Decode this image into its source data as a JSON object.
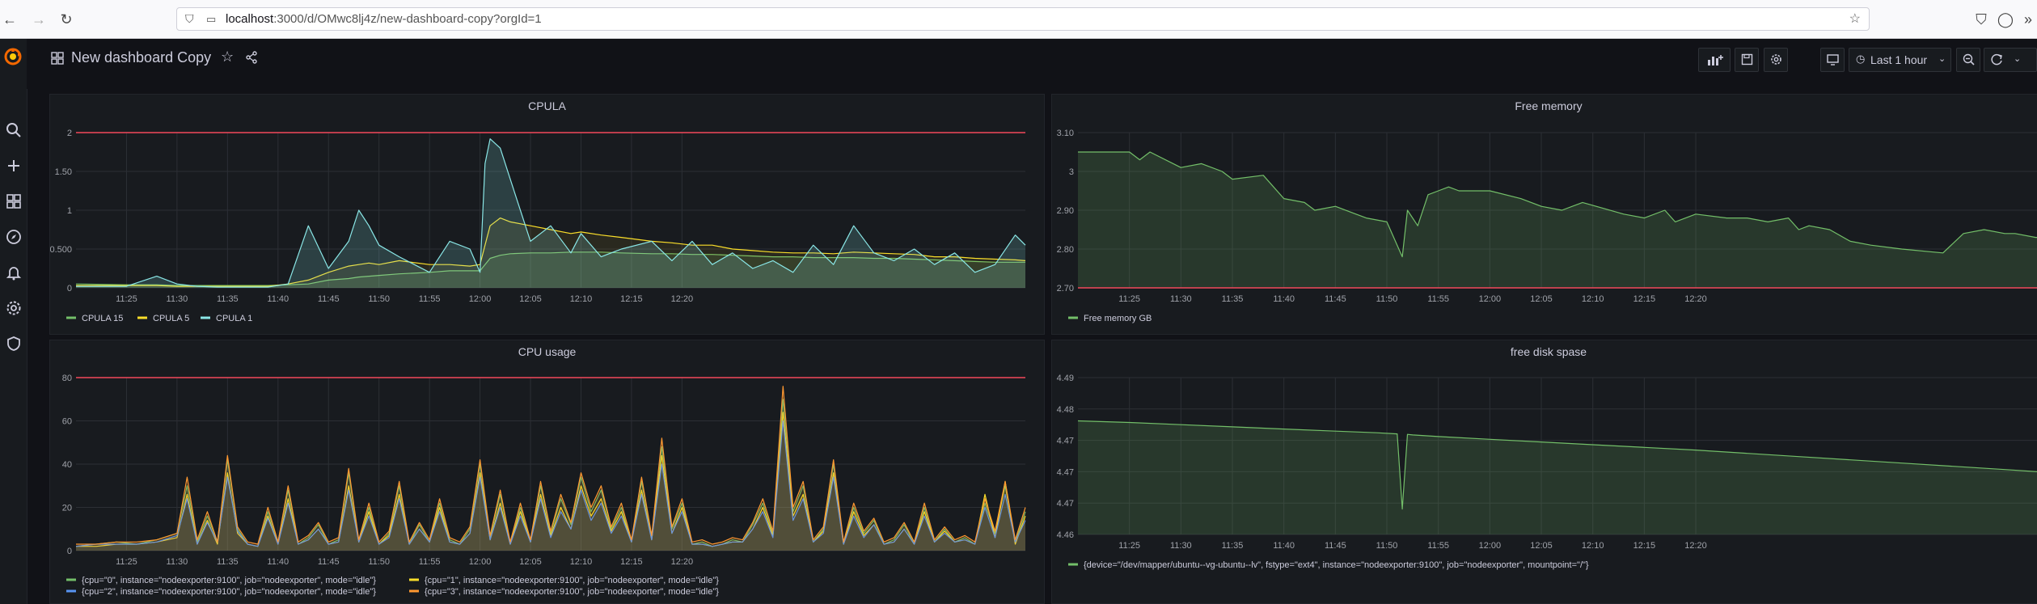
{
  "browser": {
    "url_host": "localhost",
    "url_path": ":3000/d/OMwc8lj4z/new-dashboard-copy?orgId=1"
  },
  "dashboard": {
    "title": "New dashboard Copy",
    "time_picker_label": "Last 1 hour"
  },
  "colors": {
    "green": "#73bf69",
    "yellow": "#fade2a",
    "teal": "#8ae7e7",
    "orange": "#ff9830",
    "blue": "#5794f2",
    "threshold": "#f2495c",
    "grafana_orange": "#f46800"
  },
  "panels": {
    "cpula": {
      "title": "CPULA",
      "legend": [
        "CPULA 15",
        "CPULA 5",
        "CPULA 1"
      ]
    },
    "free_memory": {
      "title": "Free memory",
      "legend": [
        "Free memory GB"
      ]
    },
    "cpu_usage": {
      "title": "CPU usage",
      "legend": [
        "{cpu=\"0\", instance=\"nodeexporter:9100\", job=\"nodeexporter\", mode=\"idle\"}",
        "{cpu=\"1\", instance=\"nodeexporter:9100\", job=\"nodeexporter\", mode=\"idle\"}",
        "{cpu=\"2\", instance=\"nodeexporter:9100\", job=\"nodeexporter\", mode=\"idle\"}",
        "{cpu=\"3\", instance=\"nodeexporter:9100\", job=\"nodeexporter\", mode=\"idle\"}"
      ]
    },
    "free_disk": {
      "title": "free disk spase",
      "legend": [
        "{device=\"/dev/mapper/ubuntu--vg-ubuntu--lv\", fstype=\"ext4\", instance=\"nodeexporter:9100\", job=\"nodeexporter\", mountpoint=\"/\"}"
      ]
    }
  },
  "chart_data": [
    {
      "type": "line",
      "title": "CPULA",
      "x_ticks": [
        "11:25",
        "11:30",
        "11:35",
        "11:40",
        "11:45",
        "11:50",
        "11:55",
        "12:00",
        "12:05",
        "12:10",
        "12:15",
        "12:20"
      ],
      "y_ticks": [
        "0",
        "0.500",
        "1",
        "1.50",
        "2"
      ],
      "ylim": [
        0,
        2
      ],
      "threshold": 2,
      "x_minutes": [
        -5,
        0,
        3,
        5,
        7,
        9,
        10,
        12,
        14,
        16,
        18,
        20,
        22,
        23,
        24,
        25,
        27,
        30,
        32,
        34,
        35,
        35.5,
        36,
        37,
        38,
        40,
        42,
        44,
        45,
        47,
        49,
        52,
        54,
        56,
        58,
        60,
        62,
        64,
        66,
        68,
        70,
        72,
        74,
        76,
        78,
        80,
        82,
        84,
        86,
        88,
        89
      ],
      "series": [
        {
          "name": "CPULA 15",
          "values": [
            0.05,
            0.04,
            0.04,
            0.03,
            0.03,
            0.03,
            0.03,
            0.03,
            0.03,
            0.04,
            0.05,
            0.1,
            0.12,
            0.14,
            0.15,
            0.16,
            0.18,
            0.2,
            0.22,
            0.22,
            0.22,
            0.3,
            0.38,
            0.42,
            0.44,
            0.45,
            0.45,
            0.46,
            0.46,
            0.46,
            0.45,
            0.44,
            0.44,
            0.43,
            0.43,
            0.42,
            0.41,
            0.4,
            0.4,
            0.39,
            0.39,
            0.39,
            0.38,
            0.38,
            0.37,
            0.36,
            0.35,
            0.34,
            0.33,
            0.33,
            0.33
          ]
        },
        {
          "name": "CPULA 5",
          "values": [
            0.03,
            0.03,
            0.03,
            0.02,
            0.02,
            0.02,
            0.02,
            0.02,
            0.02,
            0.05,
            0.1,
            0.2,
            0.28,
            0.3,
            0.32,
            0.3,
            0.35,
            0.3,
            0.3,
            0.28,
            0.3,
            0.55,
            0.8,
            0.9,
            0.85,
            0.8,
            0.75,
            0.7,
            0.72,
            0.68,
            0.65,
            0.6,
            0.58,
            0.55,
            0.55,
            0.5,
            0.48,
            0.46,
            0.45,
            0.45,
            0.44,
            0.46,
            0.45,
            0.44,
            0.43,
            0.4,
            0.4,
            0.38,
            0.37,
            0.36,
            0.35
          ]
        },
        {
          "name": "CPULA 1",
          "values": [
            0.02,
            0.02,
            0.15,
            0.05,
            0.02,
            0.01,
            0.01,
            0.01,
            0.01,
            0.05,
            0.8,
            0.25,
            0.6,
            1.0,
            0.8,
            0.55,
            0.4,
            0.2,
            0.6,
            0.5,
            0.2,
            1.6,
            1.92,
            1.8,
            1.4,
            0.6,
            0.8,
            0.45,
            0.7,
            0.4,
            0.5,
            0.6,
            0.35,
            0.6,
            0.3,
            0.45,
            0.25,
            0.35,
            0.2,
            0.55,
            0.3,
            0.8,
            0.45,
            0.35,
            0.5,
            0.3,
            0.45,
            0.2,
            0.3,
            0.68,
            0.55
          ]
        }
      ]
    },
    {
      "type": "area",
      "title": "Free memory",
      "x_ticks": [
        "11:25",
        "11:30",
        "11:35",
        "11:40",
        "11:45",
        "11:50",
        "11:55",
        "12:00",
        "12:05",
        "12:10",
        "12:15",
        "12:20"
      ],
      "y_ticks": [
        "2.70",
        "2.80",
        "2.90",
        "3",
        "3.10"
      ],
      "ylim": [
        2.7,
        3.1
      ],
      "threshold": 2.7,
      "x_minutes": [
        -5,
        0,
        1,
        2,
        5,
        7,
        9,
        10,
        13,
        15,
        17,
        18,
        20,
        22,
        23,
        25,
        26.5,
        27,
        28,
        29,
        30,
        31,
        32,
        35,
        38,
        40,
        42,
        44,
        48,
        50,
        52,
        53,
        55,
        58,
        60,
        62,
        64,
        65,
        66,
        68,
        70,
        72,
        75,
        79,
        81,
        83,
        85,
        86,
        88,
        89
      ],
      "series": [
        {
          "name": "Free memory GB",
          "values": [
            3.05,
            3.05,
            3.03,
            3.05,
            3.01,
            3.02,
            3.0,
            2.98,
            2.99,
            2.93,
            2.92,
            2.9,
            2.91,
            2.89,
            2.88,
            2.87,
            2.78,
            2.9,
            2.86,
            2.94,
            2.95,
            2.96,
            2.95,
            2.95,
            2.93,
            2.91,
            2.9,
            2.92,
            2.89,
            2.88,
            2.9,
            2.87,
            2.89,
            2.88,
            2.88,
            2.87,
            2.88,
            2.85,
            2.86,
            2.85,
            2.82,
            2.81,
            2.8,
            2.79,
            2.84,
            2.85,
            2.84,
            2.84,
            2.83,
            2.83
          ]
        }
      ]
    },
    {
      "type": "line",
      "title": "CPU usage",
      "x_ticks": [
        "11:25",
        "11:30",
        "11:35",
        "11:40",
        "11:45",
        "11:50",
        "11:55",
        "12:00",
        "12:05",
        "12:10",
        "12:15",
        "12:20"
      ],
      "y_ticks": [
        "0",
        "20",
        "40",
        "60",
        "80"
      ],
      "ylim": [
        0,
        80
      ],
      "threshold": 80,
      "x_minutes": [
        -5,
        -3,
        -1,
        1,
        3,
        5,
        6,
        7,
        8,
        9,
        10,
        11,
        12,
        13,
        14,
        15,
        16,
        17,
        18,
        19,
        20,
        21,
        22,
        23,
        24,
        25,
        26,
        27,
        28,
        29,
        30,
        31,
        32,
        33,
        34,
        35,
        36,
        37,
        38,
        39,
        40,
        41,
        42,
        43,
        44,
        45,
        46,
        47,
        48,
        49,
        50,
        51,
        52,
        53,
        54,
        55,
        56,
        57,
        58,
        59,
        60,
        61,
        62,
        63,
        64,
        65,
        66,
        67,
        68,
        69,
        70,
        71,
        72,
        73,
        74,
        75,
        76,
        77,
        78,
        79,
        80,
        81,
        82,
        83,
        84,
        85,
        86,
        87,
        88,
        89
      ],
      "series": [
        {
          "name": "{cpu=\"0\", instance=\"nodeexporter:9100\", job=\"nodeexporter\", mode=\"idle\"}",
          "values": [
            2,
            3,
            4,
            3,
            5,
            8,
            30,
            4,
            16,
            4,
            42,
            10,
            3,
            2,
            18,
            4,
            28,
            3,
            6,
            12,
            3,
            5,
            36,
            4,
            20,
            3,
            8,
            30,
            3,
            12,
            4,
            22,
            5,
            3,
            10,
            40,
            6,
            26,
            3,
            20,
            4,
            30,
            8,
            24,
            12,
            34,
            18,
            28,
            10,
            20,
            4,
            32,
            6,
            48,
            10,
            22,
            3,
            4,
            2,
            3,
            5,
            4,
            12,
            22,
            8,
            70,
            18,
            30,
            4,
            10,
            40,
            3,
            20,
            8,
            14,
            3,
            5,
            12,
            3,
            20,
            4,
            10,
            4,
            6,
            3,
            22,
            8,
            30,
            4,
            18
          ]
        },
        {
          "name": "{cpu=\"1\", instance=\"nodeexporter:9100\", job=\"nodeexporter\", mode=\"idle\"}",
          "values": [
            2,
            2,
            3,
            3,
            4,
            6,
            26,
            3,
            14,
            3,
            36,
            8,
            3,
            2,
            16,
            3,
            24,
            3,
            5,
            10,
            3,
            4,
            30,
            4,
            18,
            3,
            7,
            26,
            3,
            10,
            4,
            20,
            4,
            3,
            8,
            36,
            5,
            22,
            3,
            18,
            4,
            26,
            7,
            20,
            10,
            30,
            16,
            24,
            9,
            18,
            4,
            28,
            5,
            44,
            8,
            20,
            3,
            3,
            2,
            3,
            4,
            4,
            10,
            20,
            7,
            64,
            16,
            26,
            4,
            9,
            36,
            3,
            18,
            7,
            12,
            3,
            4,
            10,
            3,
            18,
            4,
            9,
            4,
            5,
            3,
            26,
            6,
            32,
            3,
            16
          ]
        },
        {
          "name": "{cpu=\"2\", instance=\"nodeexporter:9100\", job=\"nodeexporter\", mode=\"idle\"}",
          "values": [
            2,
            3,
            3,
            3,
            4,
            7,
            24,
            3,
            13,
            4,
            34,
            9,
            3,
            2,
            15,
            3,
            22,
            3,
            5,
            10,
            3,
            4,
            28,
            4,
            16,
            3,
            6,
            24,
            3,
            10,
            4,
            18,
            4,
            3,
            8,
            34,
            5,
            20,
            3,
            16,
            4,
            24,
            6,
            18,
            10,
            28,
            14,
            22,
            8,
            16,
            4,
            26,
            5,
            40,
            8,
            18,
            3,
            3,
            2,
            3,
            4,
            4,
            10,
            18,
            6,
            60,
            14,
            24,
            4,
            8,
            34,
            3,
            16,
            6,
            12,
            3,
            4,
            10,
            3,
            16,
            4,
            8,
            4,
            5,
            3,
            20,
            6,
            26,
            4,
            14
          ]
        },
        {
          "name": "{cpu=\"3\", instance=\"nodeexporter:9100\", job=\"nodeexporter\", mode=\"idle\"}",
          "values": [
            3,
            3,
            4,
            4,
            5,
            8,
            34,
            5,
            18,
            4,
            44,
            11,
            4,
            3,
            20,
            4,
            30,
            4,
            7,
            13,
            4,
            6,
            38,
            5,
            22,
            4,
            9,
            32,
            4,
            13,
            5,
            24,
            6,
            4,
            11,
            42,
            7,
            28,
            4,
            22,
            5,
            32,
            9,
            26,
            13,
            36,
            20,
            30,
            11,
            22,
            5,
            34,
            7,
            52,
            11,
            24,
            4,
            5,
            3,
            4,
            6,
            5,
            13,
            24,
            9,
            76,
            20,
            32,
            5,
            11,
            42,
            4,
            22,
            9,
            15,
            4,
            6,
            13,
            4,
            22,
            5,
            11,
            5,
            7,
            4,
            24,
            9,
            32,
            5,
            20
          ]
        }
      ]
    },
    {
      "type": "area",
      "title": "free disk spase",
      "x_ticks": [
        "11:25",
        "11:30",
        "11:35",
        "11:40",
        "11:45",
        "11:50",
        "11:55",
        "12:00",
        "12:05",
        "12:10",
        "12:15",
        "12:20"
      ],
      "y_ticks": [
        "4.46",
        "4.47",
        "4.47",
        "4.47",
        "4.48",
        "4.49"
      ],
      "ylim": [
        4.4605,
        4.4895
      ],
      "x_minutes": [
        -5,
        0,
        5,
        10,
        15,
        20,
        24,
        26,
        26.5,
        27,
        27.5,
        30,
        35,
        40,
        45,
        50,
        55,
        60,
        65,
        70,
        75,
        80,
        85,
        89
      ],
      "series": [
        {
          "name": "{device=\"/dev/mapper/ubuntu--vg-ubuntu--lv\", fstype=\"ext4\", instance=\"nodeexporter:9100\", job=\"nodeexporter\", mountpoint=\"/\"}",
          "values": [
            4.4815,
            4.4812,
            4.4808,
            4.4804,
            4.48,
            4.4796,
            4.4793,
            4.4791,
            4.4652,
            4.479,
            4.4789,
            4.4786,
            4.4781,
            4.4776,
            4.4771,
            4.4766,
            4.4761,
            4.4755,
            4.4749,
            4.4743,
            4.4737,
            4.4731,
            4.4725,
            4.472
          ]
        }
      ]
    }
  ]
}
